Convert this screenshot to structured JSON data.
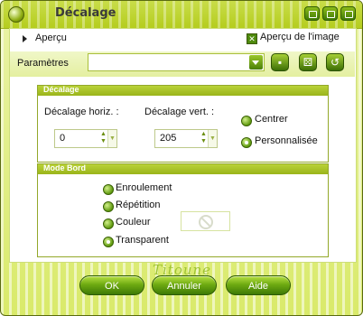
{
  "window": {
    "title": "Décalage"
  },
  "preview": {
    "tab_label": "Aperçu",
    "checkbox_label": "Aperçu de l'image",
    "checkbox_checked": true
  },
  "settings": {
    "label": "Paramètres",
    "value": ""
  },
  "offset_group": {
    "title": "Décalage",
    "horiz_label": "Décalage horiz. :",
    "horiz_value": "0",
    "vert_label": "Décalage vert. :",
    "vert_value": "205",
    "options": [
      {
        "label": "Centrer",
        "selected": false
      },
      {
        "label": "Personnalisée",
        "selected": true
      }
    ]
  },
  "edge_group": {
    "title": "Mode Bord",
    "options": [
      {
        "label": "Enroulement",
        "selected": false
      },
      {
        "label": "Répétition",
        "selected": false
      },
      {
        "label": "Couleur",
        "selected": false
      },
      {
        "label": "Transparent",
        "selected": true
      }
    ]
  },
  "signature": "Titoune",
  "buttons": {
    "ok": "OK",
    "cancel": "Annuler",
    "help": "Aide"
  },
  "colors": {
    "accent": "#6fab12",
    "dark_accent": "#3e7a05",
    "background": "#e4efa0"
  }
}
